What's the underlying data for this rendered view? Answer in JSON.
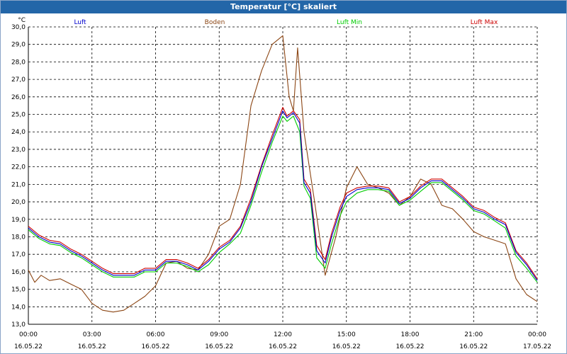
{
  "title": "Temperatur [°C] skaliert",
  "chart_data": {
    "type": "line",
    "ylabel": "°C",
    "ylim": [
      13.0,
      30.0
    ],
    "yticks": [
      "13,0",
      "14,0",
      "15,0",
      "16,0",
      "17,0",
      "18,0",
      "19,0",
      "20,0",
      "21,0",
      "22,0",
      "23,0",
      "24,0",
      "25,0",
      "26,0",
      "27,0",
      "28,0",
      "29,0",
      "30,0"
    ],
    "xlim": [
      0,
      24
    ],
    "xticks": [
      {
        "time": "00:00",
        "date": "16.05.22"
      },
      {
        "time": "03:00",
        "date": "16.05.22"
      },
      {
        "time": "06:00",
        "date": "16.05.22"
      },
      {
        "time": "09:00",
        "date": "16.05.22"
      },
      {
        "time": "12:00",
        "date": "16.05.22"
      },
      {
        "time": "15:00",
        "date": "16.05.22"
      },
      {
        "time": "18:00",
        "date": "16.05.22"
      },
      {
        "time": "21:00",
        "date": "16.05.22"
      },
      {
        "time": "00:00",
        "date": "17.05.22"
      }
    ],
    "grid": true,
    "legend_position": "top",
    "series": [
      {
        "name": "Luft",
        "color": "#0000cc",
        "points": [
          [
            0,
            18.5
          ],
          [
            0.5,
            18.0
          ],
          [
            1,
            17.7
          ],
          [
            1.5,
            17.6
          ],
          [
            2,
            17.2
          ],
          [
            2.5,
            16.9
          ],
          [
            3,
            16.5
          ],
          [
            3.5,
            16.1
          ],
          [
            4,
            15.8
          ],
          [
            4.5,
            15.8
          ],
          [
            5,
            15.8
          ],
          [
            5.5,
            16.1
          ],
          [
            6,
            16.1
          ],
          [
            6.5,
            16.6
          ],
          [
            7,
            16.6
          ],
          [
            7.5,
            16.4
          ],
          [
            8,
            16.1
          ],
          [
            8.5,
            16.6
          ],
          [
            9,
            17.3
          ],
          [
            9.5,
            17.7
          ],
          [
            10,
            18.5
          ],
          [
            10.5,
            20.0
          ],
          [
            11,
            22.0
          ],
          [
            11.5,
            23.6
          ],
          [
            12,
            25.2
          ],
          [
            12.2,
            24.8
          ],
          [
            12.5,
            25.1
          ],
          [
            12.8,
            24.5
          ],
          [
            13,
            21.1
          ],
          [
            13.3,
            20.5
          ],
          [
            13.6,
            17.2
          ],
          [
            14,
            16.5
          ],
          [
            14.3,
            18.0
          ],
          [
            14.7,
            19.5
          ],
          [
            15,
            20.3
          ],
          [
            15.5,
            20.7
          ],
          [
            16,
            20.8
          ],
          [
            16.5,
            20.8
          ],
          [
            17,
            20.7
          ],
          [
            17.5,
            19.9
          ],
          [
            18,
            20.2
          ],
          [
            18.5,
            20.8
          ],
          [
            19,
            21.2
          ],
          [
            19.5,
            21.2
          ],
          [
            20,
            20.7
          ],
          [
            20.5,
            20.2
          ],
          [
            21,
            19.6
          ],
          [
            21.5,
            19.4
          ],
          [
            22,
            19.0
          ],
          [
            22.5,
            18.7
          ],
          [
            23,
            17.1
          ],
          [
            23.5,
            16.4
          ],
          [
            24,
            15.5
          ]
        ]
      },
      {
        "name": "Boden",
        "color": "#8b4513",
        "points": [
          [
            0,
            16.1
          ],
          [
            0.3,
            15.4
          ],
          [
            0.6,
            15.8
          ],
          [
            1,
            15.5
          ],
          [
            1.5,
            15.6
          ],
          [
            2,
            15.3
          ],
          [
            2.5,
            15.0
          ],
          [
            3,
            14.2
          ],
          [
            3.5,
            13.8
          ],
          [
            4,
            13.7
          ],
          [
            4.5,
            13.8
          ],
          [
            5,
            14.2
          ],
          [
            5.5,
            14.6
          ],
          [
            6,
            15.2
          ],
          [
            6.5,
            16.5
          ],
          [
            7,
            16.6
          ],
          [
            7.5,
            16.2
          ],
          [
            8,
            16.1
          ],
          [
            8.5,
            17.0
          ],
          [
            9,
            18.6
          ],
          [
            9.5,
            19.0
          ],
          [
            10,
            21.0
          ],
          [
            10.5,
            25.5
          ],
          [
            11,
            27.5
          ],
          [
            11.5,
            29.0
          ],
          [
            12,
            29.5
          ],
          [
            12.3,
            26.0
          ],
          [
            12.5,
            25.2
          ],
          [
            12.7,
            28.8
          ],
          [
            13,
            24.0
          ],
          [
            13.5,
            20.0
          ],
          [
            14,
            15.8
          ],
          [
            14.5,
            18.0
          ],
          [
            15,
            20.8
          ],
          [
            15.5,
            22.0
          ],
          [
            16,
            21.0
          ],
          [
            16.5,
            20.8
          ],
          [
            17,
            20.5
          ],
          [
            17.5,
            19.8
          ],
          [
            18,
            20.3
          ],
          [
            18.5,
            21.3
          ],
          [
            19,
            21.0
          ],
          [
            19.5,
            19.8
          ],
          [
            20,
            19.6
          ],
          [
            20.5,
            19.0
          ],
          [
            21,
            18.3
          ],
          [
            21.5,
            18.0
          ],
          [
            22,
            17.8
          ],
          [
            22.5,
            17.6
          ],
          [
            23,
            15.6
          ],
          [
            23.5,
            14.7
          ],
          [
            24,
            14.3
          ]
        ]
      },
      {
        "name": "Luft Min",
        "color": "#00cc00",
        "points": [
          [
            0,
            18.4
          ],
          [
            0.5,
            17.9
          ],
          [
            1,
            17.6
          ],
          [
            1.5,
            17.5
          ],
          [
            2,
            17.1
          ],
          [
            2.5,
            16.8
          ],
          [
            3,
            16.4
          ],
          [
            3.5,
            16.0
          ],
          [
            4,
            15.7
          ],
          [
            4.5,
            15.7
          ],
          [
            5,
            15.7
          ],
          [
            5.5,
            16.0
          ],
          [
            6,
            16.0
          ],
          [
            6.5,
            16.5
          ],
          [
            7,
            16.5
          ],
          [
            7.5,
            16.3
          ],
          [
            8,
            16.0
          ],
          [
            8.5,
            16.4
          ],
          [
            9,
            17.1
          ],
          [
            9.5,
            17.6
          ],
          [
            10,
            18.2
          ],
          [
            10.5,
            19.8
          ],
          [
            11,
            21.7
          ],
          [
            11.5,
            23.4
          ],
          [
            12,
            24.9
          ],
          [
            12.2,
            24.6
          ],
          [
            12.5,
            24.9
          ],
          [
            12.8,
            24.0
          ],
          [
            13,
            20.9
          ],
          [
            13.3,
            20.2
          ],
          [
            13.6,
            16.8
          ],
          [
            14,
            16.2
          ],
          [
            14.3,
            17.6
          ],
          [
            14.7,
            19.2
          ],
          [
            15,
            20.0
          ],
          [
            15.5,
            20.5
          ],
          [
            16,
            20.7
          ],
          [
            16.5,
            20.7
          ],
          [
            17,
            20.6
          ],
          [
            17.5,
            19.8
          ],
          [
            18,
            20.1
          ],
          [
            18.5,
            20.6
          ],
          [
            19,
            21.1
          ],
          [
            19.5,
            21.1
          ],
          [
            20,
            20.6
          ],
          [
            20.5,
            20.1
          ],
          [
            21,
            19.5
          ],
          [
            21.5,
            19.3
          ],
          [
            22,
            18.9
          ],
          [
            22.5,
            18.5
          ],
          [
            23,
            16.9
          ],
          [
            23.5,
            16.2
          ],
          [
            24,
            15.4
          ]
        ]
      },
      {
        "name": "Luft Max",
        "color": "#cc0000",
        "points": [
          [
            0,
            18.6
          ],
          [
            0.5,
            18.1
          ],
          [
            1,
            17.8
          ],
          [
            1.5,
            17.7
          ],
          [
            2,
            17.3
          ],
          [
            2.5,
            17.0
          ],
          [
            3,
            16.6
          ],
          [
            3.5,
            16.2
          ],
          [
            4,
            15.9
          ],
          [
            4.5,
            15.9
          ],
          [
            5,
            15.9
          ],
          [
            5.5,
            16.2
          ],
          [
            6,
            16.2
          ],
          [
            6.5,
            16.7
          ],
          [
            7,
            16.7
          ],
          [
            7.5,
            16.5
          ],
          [
            8,
            16.2
          ],
          [
            8.5,
            16.7
          ],
          [
            9,
            17.4
          ],
          [
            9.5,
            17.8
          ],
          [
            10,
            18.6
          ],
          [
            10.5,
            20.2
          ],
          [
            11,
            22.1
          ],
          [
            11.5,
            23.8
          ],
          [
            12,
            25.4
          ],
          [
            12.2,
            24.9
          ],
          [
            12.5,
            25.2
          ],
          [
            12.8,
            24.7
          ],
          [
            13,
            21.3
          ],
          [
            13.3,
            20.7
          ],
          [
            13.6,
            17.5
          ],
          [
            14,
            16.7
          ],
          [
            14.3,
            18.2
          ],
          [
            14.7,
            19.7
          ],
          [
            15,
            20.5
          ],
          [
            15.5,
            20.8
          ],
          [
            16,
            20.9
          ],
          [
            16.5,
            20.9
          ],
          [
            17,
            20.8
          ],
          [
            17.5,
            20.0
          ],
          [
            18,
            20.3
          ],
          [
            18.5,
            20.9
          ],
          [
            19,
            21.3
          ],
          [
            19.5,
            21.3
          ],
          [
            20,
            20.8
          ],
          [
            20.5,
            20.3
          ],
          [
            21,
            19.7
          ],
          [
            21.5,
            19.5
          ],
          [
            22,
            19.1
          ],
          [
            22.5,
            18.8
          ],
          [
            23,
            17.2
          ],
          [
            23.5,
            16.5
          ],
          [
            24,
            15.6
          ]
        ]
      }
    ]
  }
}
